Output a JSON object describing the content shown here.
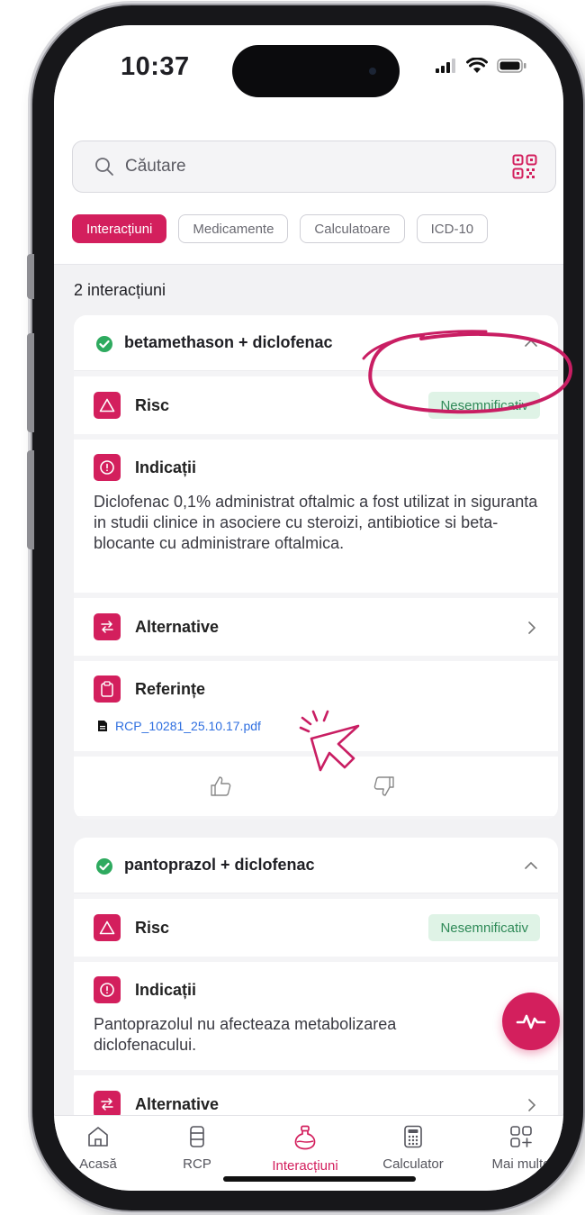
{
  "status": {
    "time": "10:37"
  },
  "search": {
    "placeholder": "Căutare"
  },
  "filters": [
    {
      "label": "Interacțiuni",
      "active": true
    },
    {
      "label": "Medicamente",
      "active": false
    },
    {
      "label": "Calculatoare",
      "active": false
    },
    {
      "label": "ICD-10",
      "active": false
    }
  ],
  "results_count": "2 interacțiuni",
  "cards": [
    {
      "title": "betamethason + diclofenac",
      "risk_label": "Risc",
      "risk_badge": "Nesemnificativ",
      "indications_label": "Indicații",
      "indications_text": "Diclofenac 0,1% administrat oftalmic a fost utilizat in siguranta in studii clinice in asociere cu steroizi, antibiotice si beta-blocante cu administrare oftalmica.",
      "alternatives_label": "Alternative",
      "references_label": "Referințe",
      "reference_file": "RCP_10281_25.10.17.pdf"
    },
    {
      "title": "pantoprazol + diclofenac",
      "risk_label": "Risc",
      "risk_badge": "Nesemnificativ",
      "indications_label": "Indicații",
      "indications_text": "Pantoprazolul nu afecteaza metabolizarea diclofenacului.",
      "alternatives_label": "Alternative"
    }
  ],
  "tabbar": [
    {
      "label": "Acasă",
      "icon": "home-icon",
      "active": false
    },
    {
      "label": "RCP",
      "icon": "document-stack-icon",
      "active": false
    },
    {
      "label": "Interacțiuni",
      "icon": "flask-icon",
      "active": true
    },
    {
      "label": "Calculator",
      "icon": "calculator-icon",
      "active": false
    },
    {
      "label": "Mai multe",
      "icon": "more-grid-icon",
      "active": false
    }
  ],
  "colors": {
    "accent": "#d31f5d",
    "badge_bg": "#dff3e6",
    "badge_text": "#2f8a58",
    "link": "#2f6fe0",
    "ok_green": "#2eaa5f"
  }
}
